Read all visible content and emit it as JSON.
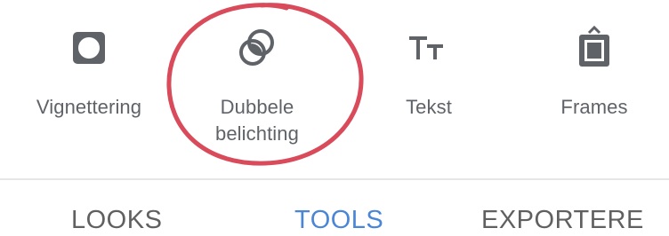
{
  "tools": [
    {
      "id": "vignette",
      "icon": "vignette-icon",
      "label_lines": [
        "Vignettering"
      ]
    },
    {
      "id": "double",
      "icon": "double-exposure-icon",
      "label_lines": [
        "Dubbele",
        "belichting"
      ]
    },
    {
      "id": "text",
      "icon": "text-icon",
      "label_lines": [
        "Tekst"
      ]
    },
    {
      "id": "frames",
      "icon": "frames-icon",
      "label_lines": [
        "Frames"
      ]
    }
  ],
  "annotation": {
    "color": "#d94b5a",
    "target": "double"
  },
  "tabs": [
    {
      "id": "looks",
      "label": "LOOKS",
      "active": false
    },
    {
      "id": "tools",
      "label": "TOOLS",
      "active": true
    },
    {
      "id": "export",
      "label": "EXPORTERE",
      "active": false
    }
  ],
  "colors": {
    "icon": "#5f6368",
    "text": "#5f6368",
    "active_tab": "#4a86d8",
    "divider": "#e6e6e6"
  }
}
